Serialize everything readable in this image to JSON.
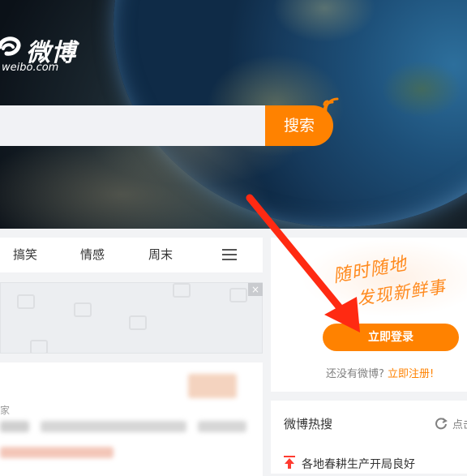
{
  "header": {
    "logo_text": "微博",
    "logo_sub": "weibo.com",
    "search": {
      "button_label": "搜索",
      "value": ""
    }
  },
  "nav": {
    "items": [
      {
        "label": "搞笑"
      },
      {
        "label": "情感"
      },
      {
        "label": "周末"
      }
    ]
  },
  "feed": {
    "partial_text": "家"
  },
  "login": {
    "slogan_line1": "随时随地",
    "slogan_line2": "发现新鲜事",
    "login_button": "立即登录",
    "no_account_text": "还没有微博?",
    "register_link": "立即注册!"
  },
  "hot": {
    "title": "微博热搜",
    "refresh_label": "点击",
    "items": [
      {
        "text": "各地春耕生产开局良好"
      }
    ]
  },
  "colors": {
    "brand_orange": "#ff8200",
    "annotation_arrow": "#ff2a12"
  }
}
